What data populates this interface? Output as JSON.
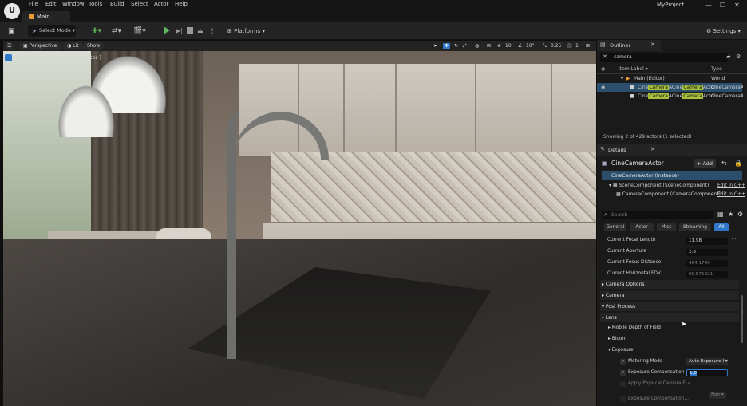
{
  "app": {
    "menu": [
      "File",
      "Edit",
      "Window",
      "Tools",
      "Build",
      "Select",
      "Actor",
      "Help"
    ],
    "level_tab": "Main",
    "project": "MyProject",
    "window_controls": [
      "—",
      "❐",
      "✕"
    ]
  },
  "toolbar": {
    "select_mode": "Select Mode",
    "platforms": "Platforms",
    "settings": "Settings"
  },
  "viewport": {
    "view_mode": "Perspective",
    "lit": "Lit",
    "show": "Show",
    "pilot_label": "[ Pilot Active - CineCameraActor ]",
    "snap_grid": "10",
    "snap_rotation": "10°",
    "snap_scale": "0.25",
    "camera_speed": "1"
  },
  "outliner": {
    "title": "Outliner",
    "search_value": "camera",
    "col_label": "Item Label",
    "col_type": "Type",
    "rows": [
      {
        "pre": "Main (Editor)",
        "hl": "",
        "post": "",
        "type": "World"
      },
      {
        "pre": "Cine",
        "hl": "Camera",
        "post": "A",
        "pre2": "Cine",
        "hl2": "Camera",
        "post2": "Actor",
        "type": "CineCameraActor"
      },
      {
        "pre": "Cine",
        "hl": "Camera",
        "post": "A",
        "pre2": "Cine",
        "hl2": "Camera",
        "post2": "Actor",
        "type": "CineCameraActor"
      }
    ],
    "status": "Showing 2 of 429 actors (1 selected)"
  },
  "details": {
    "title": "Details",
    "actor_name": "CineCameraActor",
    "add_button": "+ Add",
    "instance": "CineCameraActor (Instance)",
    "components": [
      {
        "label": "SceneComponent (SceneComponent)",
        "link": "Edit in C++"
      },
      {
        "label": "CameraComponent (CameraComponent)",
        "link": "Edit in C++"
      }
    ],
    "search_placeholder": "Search",
    "filters": [
      "General",
      "Actor",
      "Misc",
      "Streaming",
      "All"
    ],
    "properties": [
      {
        "label": "Current Focal Length",
        "value": "11.98"
      },
      {
        "label": "Current Aperture",
        "value": "2.8"
      },
      {
        "label": "Current Focus Distance",
        "value": "464.1746"
      },
      {
        "label": "Current Horizontal FOV",
        "value": "90.575821"
      }
    ],
    "sections": [
      "Camera Options",
      "Camera",
      "Post Process",
      "Lens",
      "Mobile Depth of Field",
      "Bloom",
      "Exposure"
    ],
    "exposure_props": [
      {
        "label": "Metering Mode",
        "value": "Auto Exposure I"
      },
      {
        "label": "Exposure Compensation",
        "value": "1.0"
      },
      {
        "label": "Apply Physical Camera E...",
        "value": "✓"
      },
      {
        "label": "Exposure Compensation...",
        "value": "Non"
      }
    ]
  },
  "colors": {
    "accent_blue": "#2f77c8",
    "highlight_green": "#a8c23b",
    "play_green": "#5cb85c"
  }
}
